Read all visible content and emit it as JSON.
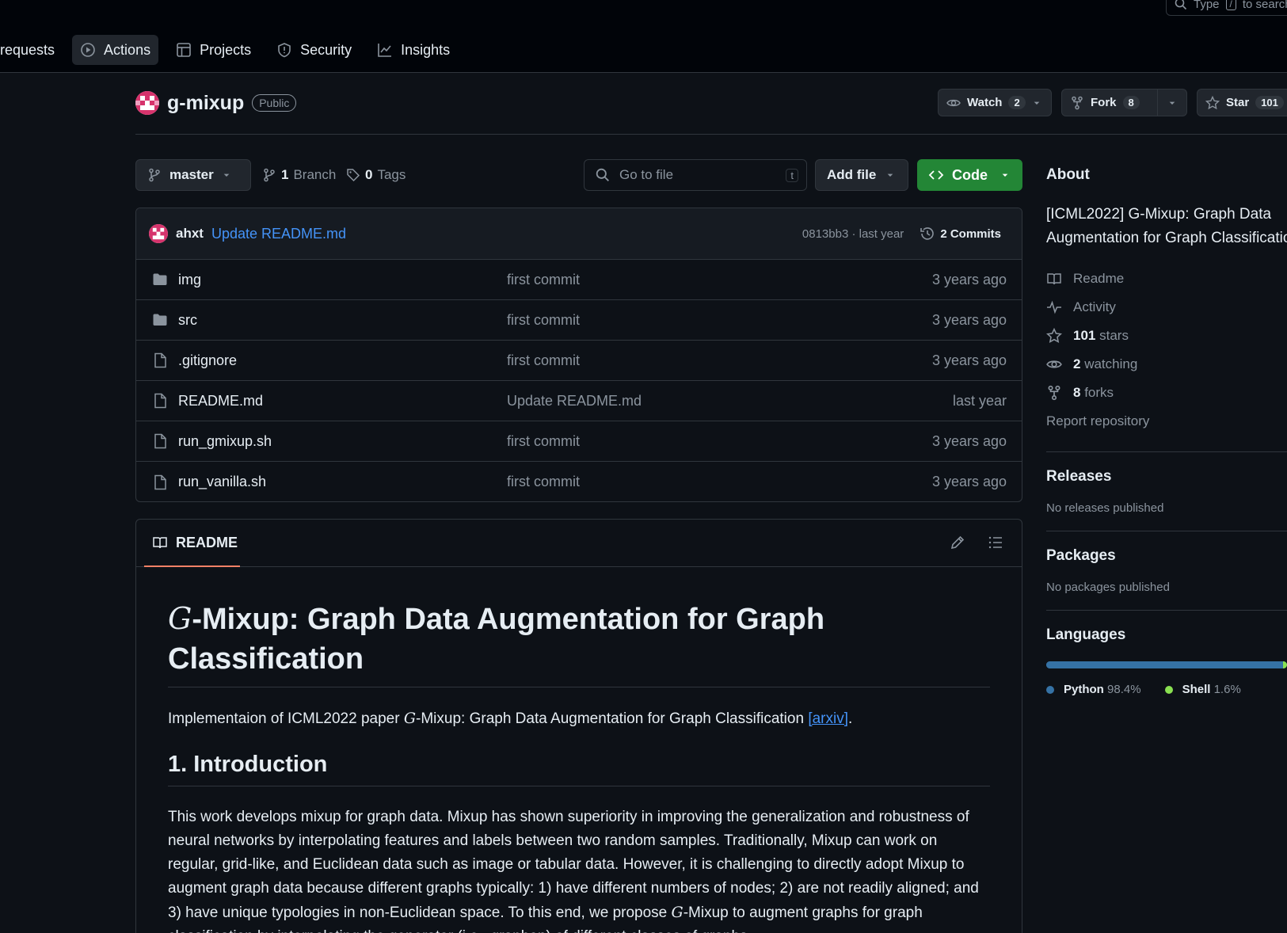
{
  "header": {
    "search_prefix": "Type",
    "search_key": "/",
    "search_suffix": "to search",
    "nav": [
      {
        "label": "requests",
        "icon": "pull-request-icon"
      },
      {
        "label": "Actions",
        "icon": "play-icon"
      },
      {
        "label": "Projects",
        "icon": "table-icon"
      },
      {
        "label": "Security",
        "icon": "shield-icon"
      },
      {
        "label": "Insights",
        "icon": "graph-icon"
      }
    ]
  },
  "repo": {
    "name": "g-mixup",
    "visibility": "Public",
    "watch_label": "Watch",
    "watch_count": "2",
    "fork_label": "Fork",
    "fork_count": "8",
    "star_label": "Star",
    "star_count": "101"
  },
  "toolbar": {
    "branch": "master",
    "branches_count": "1",
    "branches_label": "Branch",
    "tags_count": "0",
    "tags_label": "Tags",
    "goto_placeholder": "Go to file",
    "goto_key": "t",
    "add_file": "Add file",
    "code": "Code"
  },
  "commit": {
    "author": "ahxt",
    "message": "Update README.md",
    "hash_time": "0813bb3 · last year",
    "commits_label": "2 Commits"
  },
  "files": [
    {
      "name": "img",
      "type": "folder",
      "commit": "first commit",
      "time": "3 years ago"
    },
    {
      "name": "src",
      "type": "folder",
      "commit": "first commit",
      "time": "3 years ago"
    },
    {
      "name": ".gitignore",
      "type": "file",
      "commit": "first commit",
      "time": "3 years ago"
    },
    {
      "name": "README.md",
      "type": "file",
      "commit": "Update README.md",
      "time": "last year"
    },
    {
      "name": "run_gmixup.sh",
      "type": "file",
      "commit": "first commit",
      "time": "3 years ago"
    },
    {
      "name": "run_vanilla.sh",
      "type": "file",
      "commit": "first commit",
      "time": "3 years ago"
    }
  ],
  "readme": {
    "tab": "README",
    "title_math": "G",
    "title_rest": "-Mixup: Graph Data Augmentation for Graph Classification",
    "intro_pre": "Implementaion of ICML2022 paper ",
    "intro_math": "G",
    "intro_post": "-Mixup: Graph Data Augmentation for Graph Classification ",
    "intro_link": "[arxiv]",
    "intro_end": ".",
    "section1": "1. Introduction",
    "body_text": "This work develops mixup for graph data. Mixup has shown superiority in improving the generalization and robustness of neural networks by interpolating features and labels between two random samples. Traditionally, Mixup can work on regular, grid-like, and Euclidean data such as image or tabular data. However, it is challenging to directly adopt Mixup to augment graph data because different graphs typically: 1) have different numbers of nodes; 2) are not readily aligned; and 3) have unique typologies in non-Euclidean space. To this end, we propose ",
    "body_math": "G",
    "body_tail": "-Mixup to augment graphs for graph classification by interpolating the generator (i.e., graphon) of different classes of graphs."
  },
  "sidebar": {
    "about_title": "About",
    "about_line1": "[ICML2022] G-Mixup: Graph Data",
    "about_line2": "Augmentation for Graph Classification",
    "readme": "Readme",
    "activity": "Activity",
    "stars_count": "101",
    "stars_label": "stars",
    "watching_count": "2",
    "watching_label": "watching",
    "forks_count": "8",
    "forks_label": "forks",
    "report": "Report repository",
    "releases_title": "Releases",
    "releases_text": "No releases published",
    "packages_title": "Packages",
    "packages_text": "No packages published",
    "languages_title": "Languages",
    "languages": [
      {
        "name": "Python",
        "percent": "98.4%",
        "share": 98.4,
        "color": "#3572a5"
      },
      {
        "name": "Shell",
        "percent": "1.6%",
        "share": 1.6,
        "color": "#89e051"
      }
    ]
  },
  "colors": {
    "accent_link": "#4493f8",
    "code_button": "#238636",
    "tab_underline": "#f78166"
  }
}
